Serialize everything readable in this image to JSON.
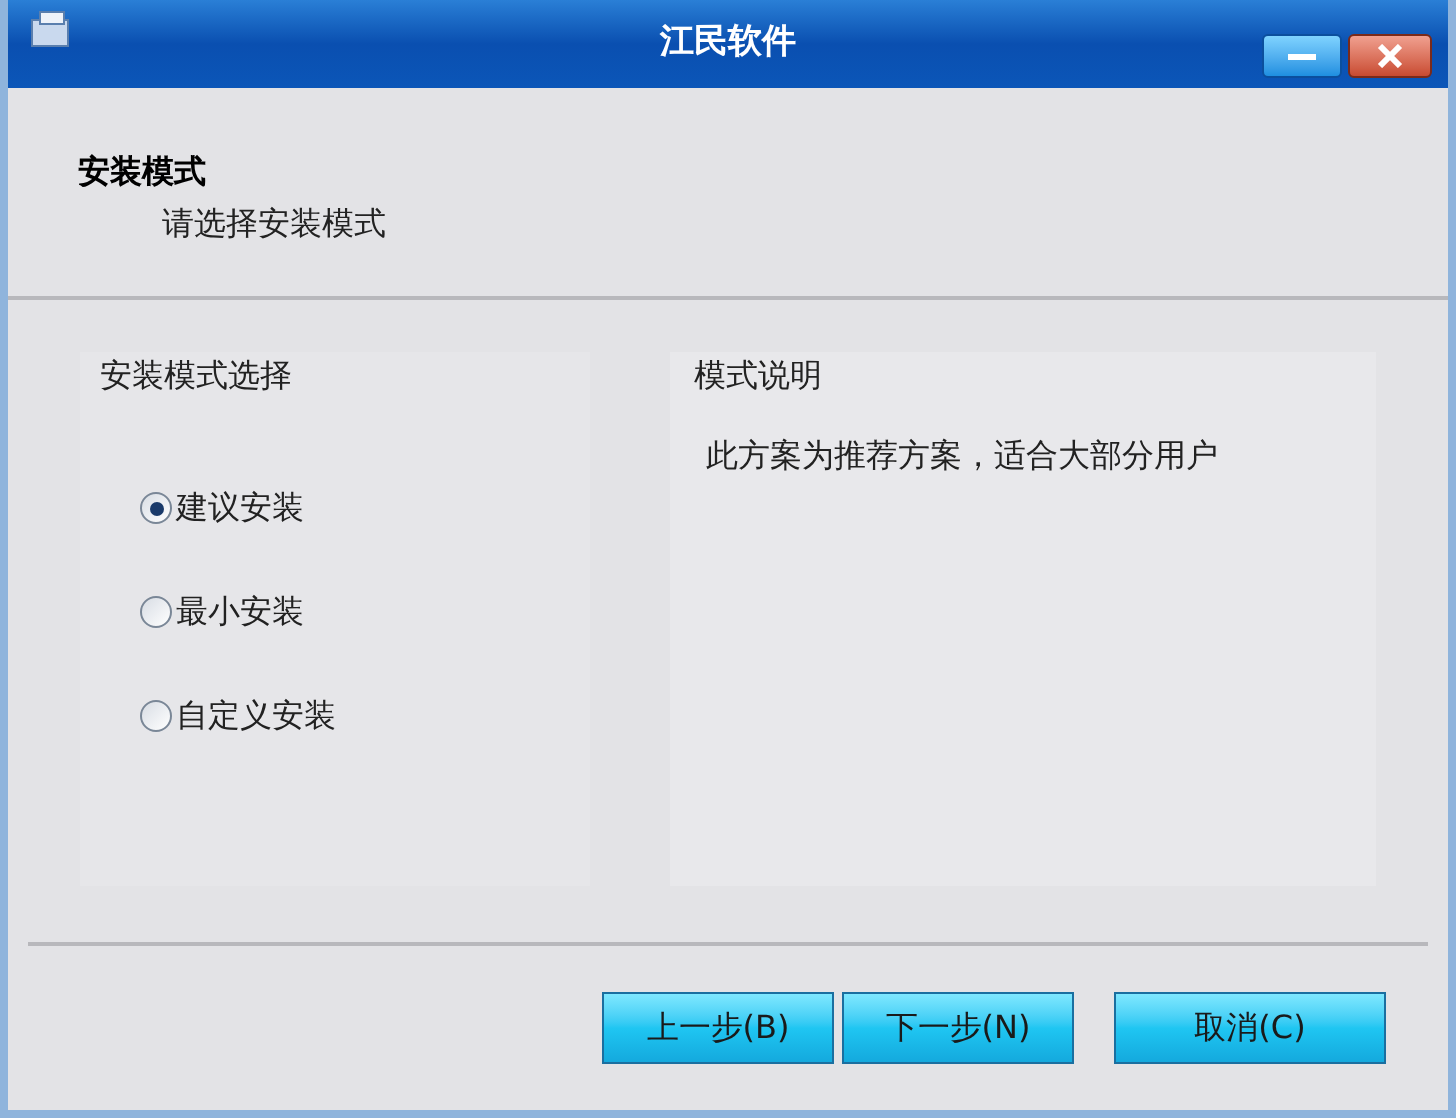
{
  "window": {
    "title": "江民软件"
  },
  "header": {
    "title": "安装模式",
    "subtitle": "请选择安装模式"
  },
  "mode_group": {
    "title": "安装模式选择",
    "options": [
      {
        "label": "建议安装",
        "selected": true
      },
      {
        "label": "最小安装",
        "selected": false
      },
      {
        "label": "自定义安装",
        "selected": false
      }
    ]
  },
  "description": {
    "title": "模式说明",
    "text": "此方案为推荐方案，适合大部分用户"
  },
  "buttons": [
    "上一步(B)",
    "下一步(N)",
    "取消(C)"
  ]
}
